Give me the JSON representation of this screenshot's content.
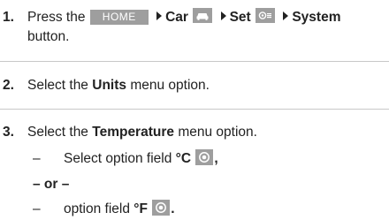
{
  "steps": [
    {
      "num": "1.",
      "t1": "Press the",
      "home_btn": "HOME",
      "car": "Car",
      "set": "Set",
      "system": "System",
      "t2": "button."
    },
    {
      "num": "2.",
      "t1": "Select the",
      "bold": "Units",
      "t2": "menu option."
    },
    {
      "num": "3.",
      "t1": "Select the",
      "bold": "Temperature",
      "t2": "menu option."
    }
  ],
  "sub": {
    "dash": "–",
    "opt_c_text": "Select option field",
    "opt_c": "°C",
    "opt_c_punct": ",",
    "or_text": "– or –",
    "opt_f_text": "option field",
    "opt_f": "°F",
    "opt_f_punct": "."
  },
  "icons": {
    "car": "car-icon",
    "settings": "settings-icon",
    "radio": "radio-select-icon"
  },
  "colors": {
    "button_bg": "#9e9e9e",
    "text": "#222222",
    "separator": "#c8c8c8"
  }
}
